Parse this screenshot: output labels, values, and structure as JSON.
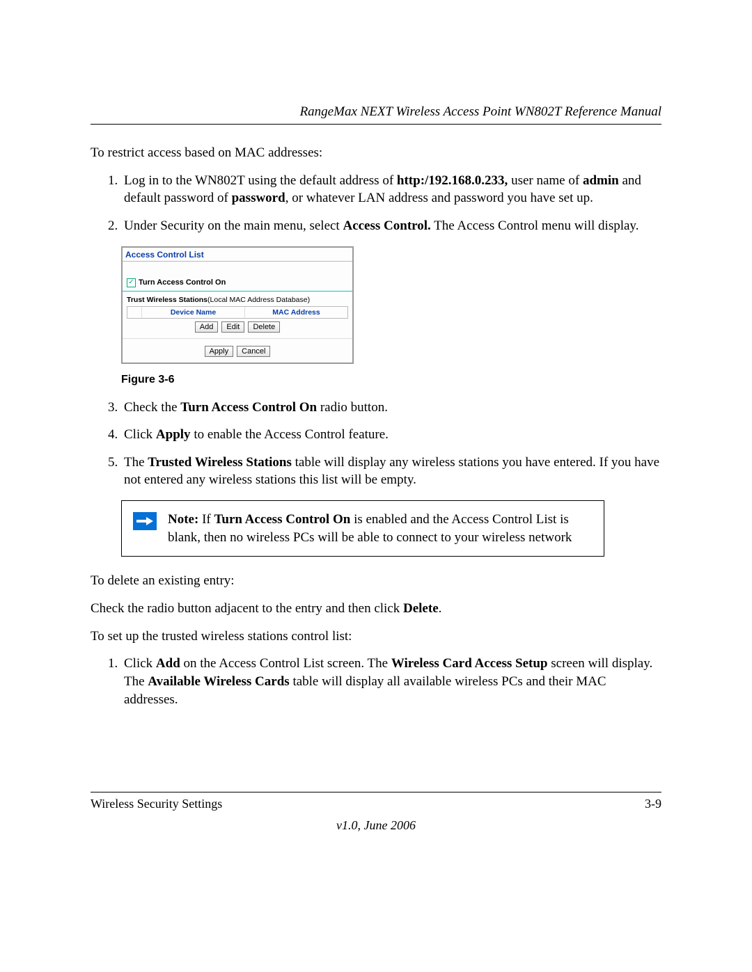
{
  "header": {
    "title": "RangeMax NEXT Wireless Access Point WN802T Reference Manual"
  },
  "intro": "To restrict access based on MAC addresses:",
  "steps_a": [
    {
      "pre": "Log in to the WN802T using the default address of ",
      "b1": "http:/192.168.0.233,",
      "mid1": " user name of ",
      "b2": "admin",
      "mid2": " and default password of ",
      "b3": "password",
      "post": ", or whatever LAN address and password you have set up."
    },
    {
      "pre": "Under Security on the main menu, select ",
      "b1": "Access Control.",
      "post": " The Access Control menu will display."
    }
  ],
  "screenshot": {
    "title": "Access Control List",
    "checkbox_mark": "✓",
    "checkbox_label": "Turn Access Control On",
    "trust_label_bold": "Trust Wireless Stations",
    "trust_label_rest": "(Local MAC Address Database)",
    "col_device": "Device Name",
    "col_mac": "MAC Address",
    "buttons1": {
      "add": "Add",
      "edit": "Edit",
      "delete": "Delete"
    },
    "buttons2": {
      "apply": "Apply",
      "cancel": "Cancel"
    }
  },
  "figure_caption": "Figure 3-6",
  "steps_b": [
    {
      "num": "3.",
      "pre": "Check the ",
      "b1": "Turn Access Control On",
      "post": " radio button."
    },
    {
      "num": "4.",
      "pre": "Click ",
      "b1": "Apply",
      "post": " to enable the Access Control feature."
    },
    {
      "num": "5.",
      "pre": "The ",
      "b1": "Trusted Wireless Stations",
      "post": " table will display any wireless stations you have entered. If you have not entered any wireless stations this list will be empty."
    }
  ],
  "note": {
    "label": "Note:",
    "pre": " If ",
    "b1": "Turn Access Control On",
    "post": " is enabled and the Access Control List is blank, then no wireless PCs will be able to connect to your wireless network"
  },
  "delete_intro": "To delete an existing entry:",
  "delete_text_pre": "Check the radio button adjacent to the entry and then click ",
  "delete_text_b": "Delete",
  "delete_text_post": ".",
  "setup_intro": "To set up the trusted wireless stations control list:",
  "steps_c": [
    {
      "pre": "Click ",
      "b1": "Add",
      "mid1": " on the Access Control List screen. The ",
      "b2": "Wireless Card Access Setup",
      "mid2": " screen will display. The ",
      "b3": "Available Wireless Cards",
      "post": " table will display all available wireless PCs and their MAC addresses."
    }
  ],
  "footer": {
    "left": "Wireless Security Settings",
    "right": "3-9",
    "version": "v1.0, June 2006"
  }
}
